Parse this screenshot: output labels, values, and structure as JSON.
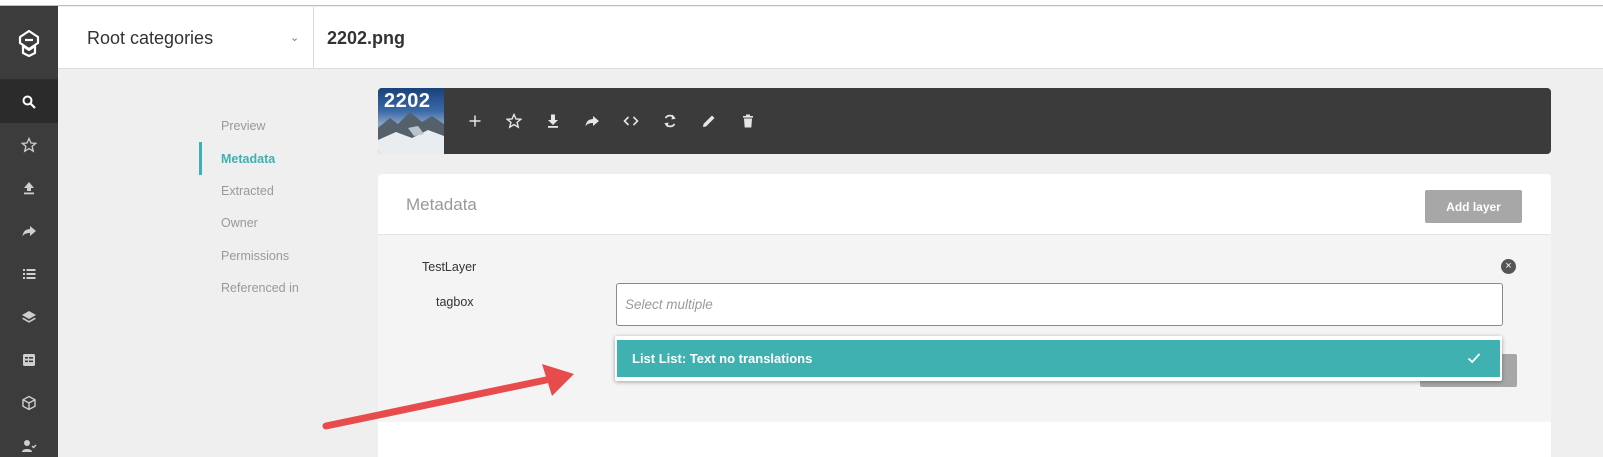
{
  "header": {
    "category_select": "Root categories",
    "page_title": "2202.png"
  },
  "sidebar": {
    "items": [
      {
        "icon": "search-icon",
        "active": true
      },
      {
        "icon": "star-icon"
      },
      {
        "icon": "upload-icon"
      },
      {
        "icon": "share-icon"
      },
      {
        "icon": "list-icon"
      },
      {
        "icon": "layers-icon"
      },
      {
        "icon": "table-icon"
      },
      {
        "icon": "cube-icon"
      },
      {
        "icon": "user-check-icon"
      }
    ]
  },
  "leftnav": {
    "items": [
      "Preview",
      "Metadata",
      "Extracted",
      "Owner",
      "Permissions",
      "Referenced in"
    ],
    "active": "Metadata"
  },
  "toolbar": {
    "thumbnail_text": "2202",
    "tools": [
      "add-icon",
      "star-icon",
      "download-icon",
      "share-icon",
      "embed-code-icon",
      "refresh-icon",
      "edit-icon",
      "delete-icon"
    ]
  },
  "metadata": {
    "title": "Metadata",
    "add_layer_label": "Add layer",
    "layer": {
      "name": "TestLayer",
      "field_label": "tagbox",
      "input_placeholder": "Select multiple"
    }
  },
  "dropdown": {
    "options": [
      {
        "label": "List List: Text no translations",
        "selected": true
      }
    ]
  },
  "colors": {
    "accent": "#3fb1b0",
    "sidebar": "#3c3c3c",
    "toolbar": "#3b3b3b",
    "annotation_arrow": "#e84b4b"
  }
}
